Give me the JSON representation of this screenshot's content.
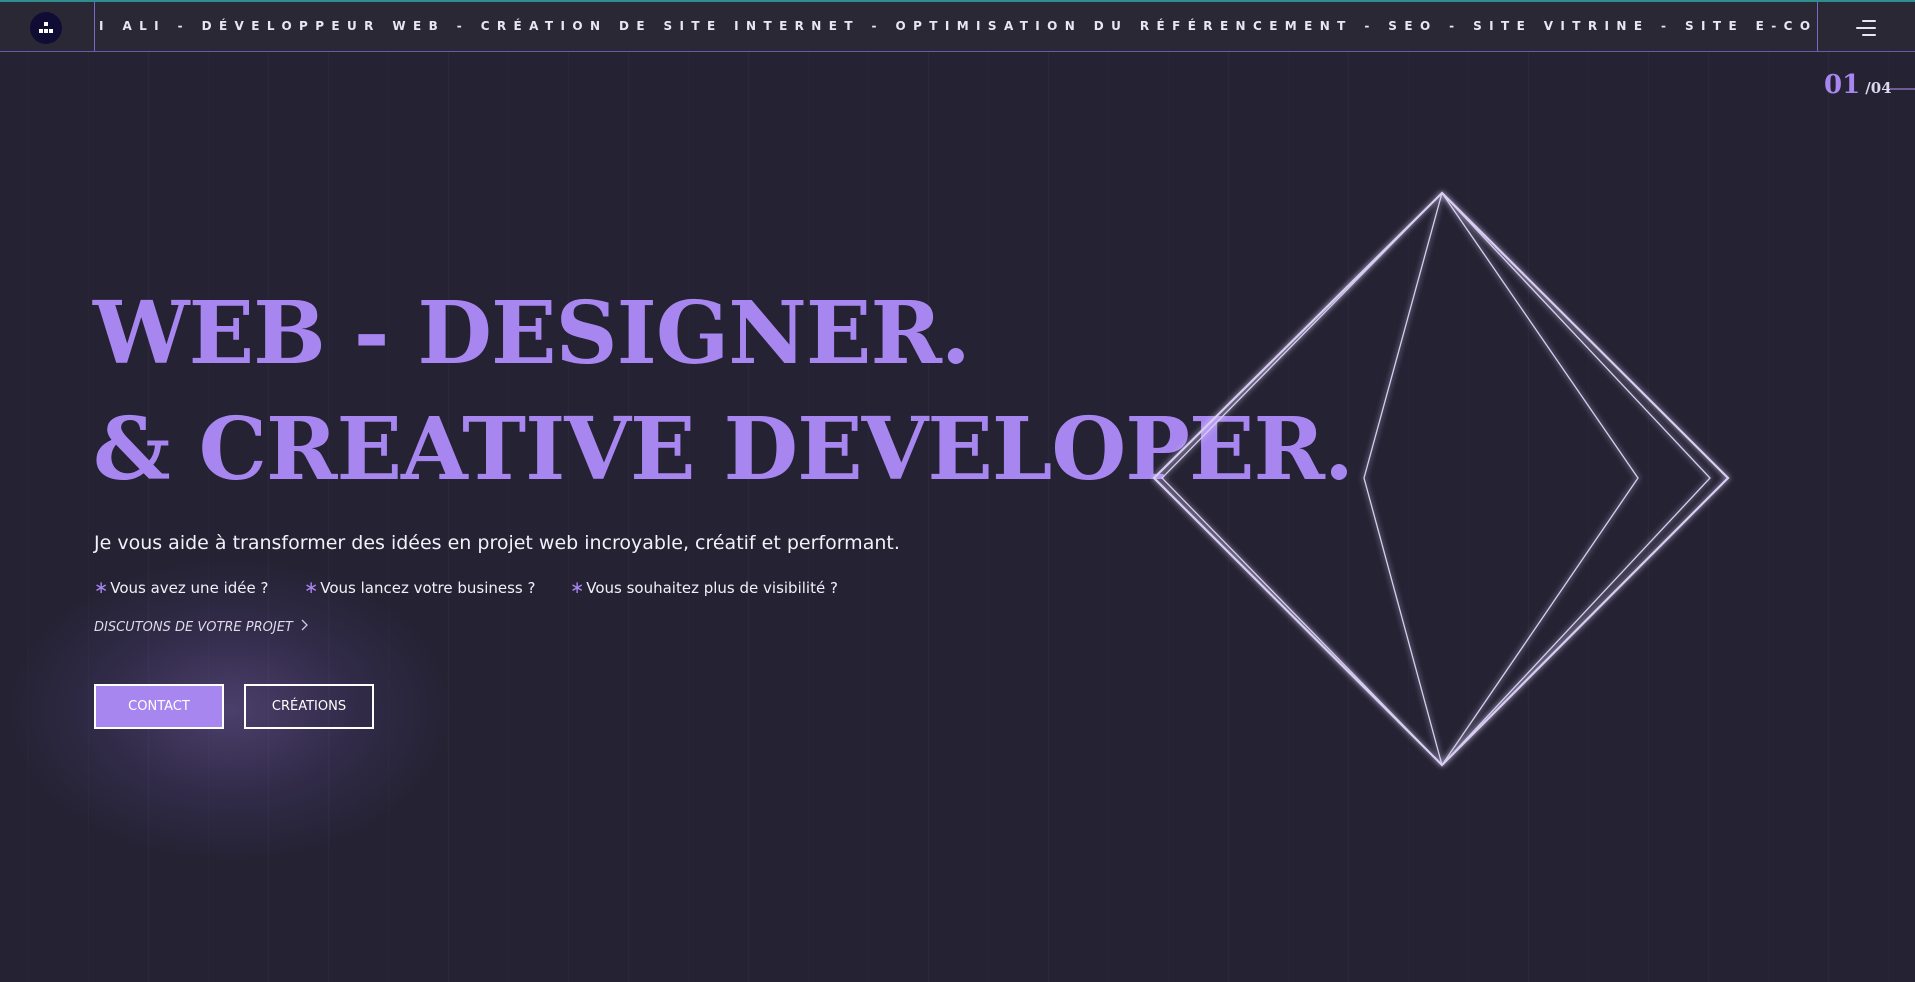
{
  "header": {
    "logo_icon": "logo-icon",
    "marquee_text": "I ALI - DÉVELOPPEUR WEB - CRÉATION DE SITE INTERNET - OPTIMISATION DU RÉFÉRENCEMENT - SEO - SITE VITRINE - SITE E-COMMERCE -K",
    "menu_icon": "hamburger-menu-icon"
  },
  "slide_counter": {
    "current": "01",
    "total": "/04"
  },
  "hero": {
    "title_line1": "WEB - DESIGNER.",
    "title_line2": "& CREATIVE DEVELOPER.",
    "subtitle": "Je vous aide à transformer des idées en projet web incroyable, créatif et performant.",
    "bullets": [
      "Vous avez une idée ?",
      "Vous lancez votre business ?",
      "Vous souhaitez plus de visibilité ?"
    ],
    "bullet_symbol": "∗",
    "discuss_link": "DISCUTONS DE VOTRE PROJET",
    "contact_button": "CONTACT",
    "creations_button": "CRÉATIONS"
  },
  "colors": {
    "background": "#242233",
    "accent": "#a886f0",
    "header_top_border": "#2f8d8f",
    "text": "#f2f0f8"
  }
}
